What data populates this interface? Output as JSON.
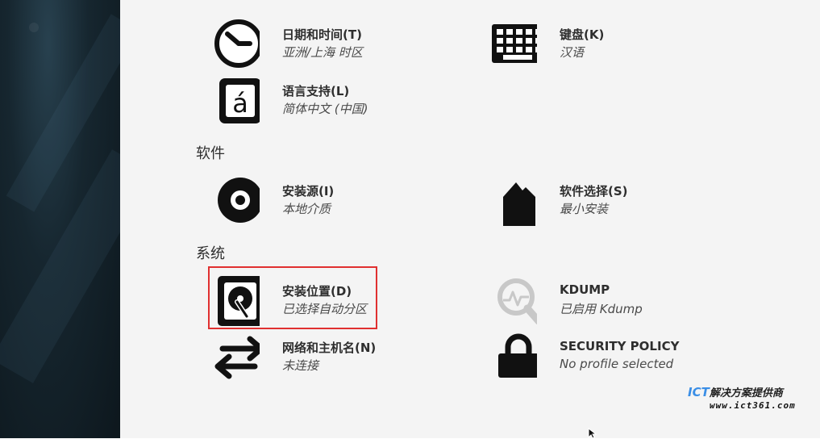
{
  "sections": {
    "software": "软件",
    "system": "系统"
  },
  "spokes": {
    "datetime": {
      "title": "日期和时间(T)",
      "status": "亚洲/上海 时区",
      "icon": "clock-icon"
    },
    "keyboard": {
      "title": "键盘(K)",
      "status": "汉语",
      "icon": "keyboard-icon"
    },
    "language": {
      "title": "语言支持(L)",
      "status": "简体中文 (中国)",
      "icon": "language-icon"
    },
    "source": {
      "title": "安装源(I)",
      "status": "本地介质",
      "icon": "disc-icon"
    },
    "software": {
      "title": "软件选择(S)",
      "status": "最小安装",
      "icon": "package-icon"
    },
    "destination": {
      "title": "安装位置(D)",
      "status": "已选择自动分区",
      "icon": "harddisk-icon"
    },
    "kdump": {
      "title": "KDUMP",
      "status": "已启用 Kdump",
      "icon": "kdump-search-icon"
    },
    "network": {
      "title": "网络和主机名(N)",
      "status": "未连接",
      "icon": "network-arrows-icon"
    },
    "security": {
      "title": "SECURITY POLICY",
      "status": "No profile selected",
      "icon": "lock-icon"
    }
  },
  "watermark": {
    "brand": "ICT",
    "text": "解决方案提供商",
    "url": "www.ict361.com"
  },
  "colors": {
    "highlight": "#e03030",
    "background": "#f4f4f4",
    "sidebar": "#16262f"
  }
}
